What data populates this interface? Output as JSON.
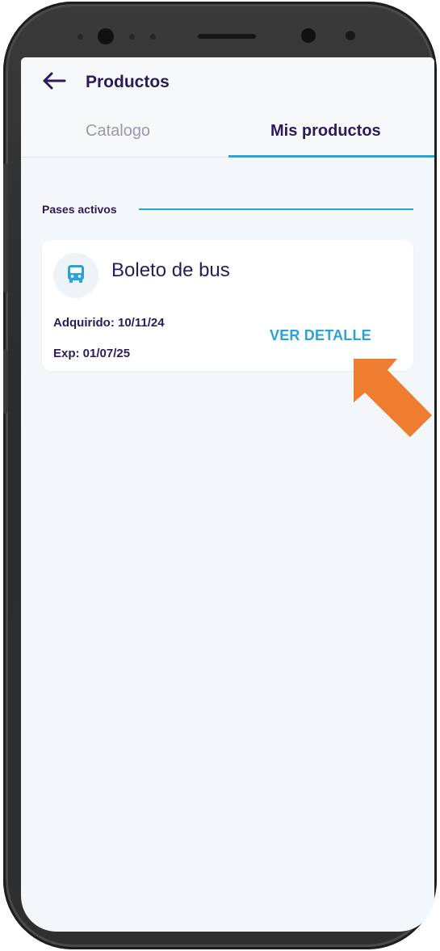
{
  "header": {
    "title": "Productos",
    "back_icon": "arrow-left-icon"
  },
  "tabs": [
    {
      "label": "Catalogo",
      "active": false
    },
    {
      "label": "Mis productos",
      "active": true
    }
  ],
  "section": {
    "label": "Pases activos"
  },
  "cards": [
    {
      "icon": "bus-icon",
      "title": "Boleto de bus",
      "acquired": "Adquirido: 10/11/24",
      "expires": "Exp: 01/07/25",
      "action_label": "VER DETALLE"
    }
  ],
  "colors": {
    "primary_text": "#2b1b5e",
    "accent": "#2aa3dd",
    "inactive_tab": "#9c97ad",
    "background": "#f4f7f9",
    "annotation_arrow": "#ee7d2f"
  }
}
